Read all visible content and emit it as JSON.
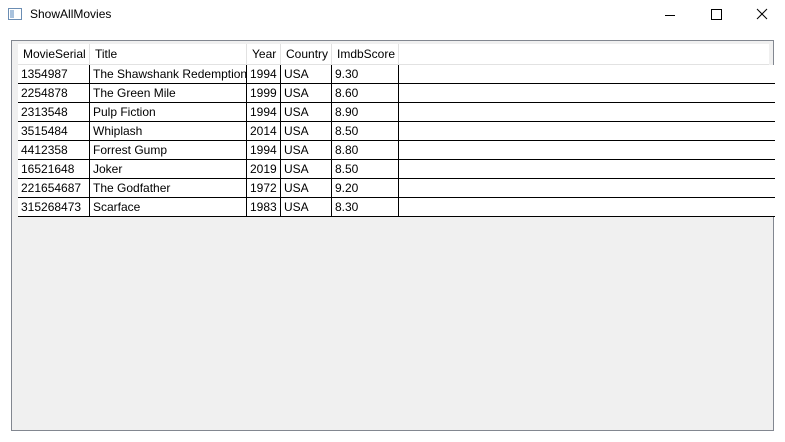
{
  "window": {
    "title": "ShowAllMovies",
    "icon": "app-window-icon",
    "controls": {
      "minimize_icon": "minimize-icon",
      "maximize_icon": "maximize-icon",
      "close_icon": "close-icon"
    }
  },
  "grid": {
    "columns": [
      "MovieSerial",
      "Title",
      "Year",
      "Country",
      "ImdbScore"
    ],
    "rows": [
      [
        "1354987",
        "The Shawshank Redemption",
        "1994",
        "USA",
        "9.30"
      ],
      [
        "2254878",
        "The Green Mile",
        "1999",
        "USA",
        "8.60"
      ],
      [
        "2313548",
        "Pulp Fiction",
        "1994",
        "USA",
        "8.90"
      ],
      [
        "3515484",
        "Whiplash",
        "2014",
        "USA",
        "8.50"
      ],
      [
        "4412358",
        "Forrest Gump",
        "1994",
        "USA",
        "8.80"
      ],
      [
        "16521648",
        "Joker",
        "2019",
        "USA",
        "8.50"
      ],
      [
        "221654687",
        "The Godfather",
        "1972",
        "USA",
        "9.20"
      ],
      [
        "315268473",
        "Scarface",
        "1983",
        "USA",
        "8.30"
      ]
    ]
  },
  "colors": {
    "grid_background": "#f0f0f0",
    "frame_border": "#828790",
    "row_line": "#000000"
  }
}
